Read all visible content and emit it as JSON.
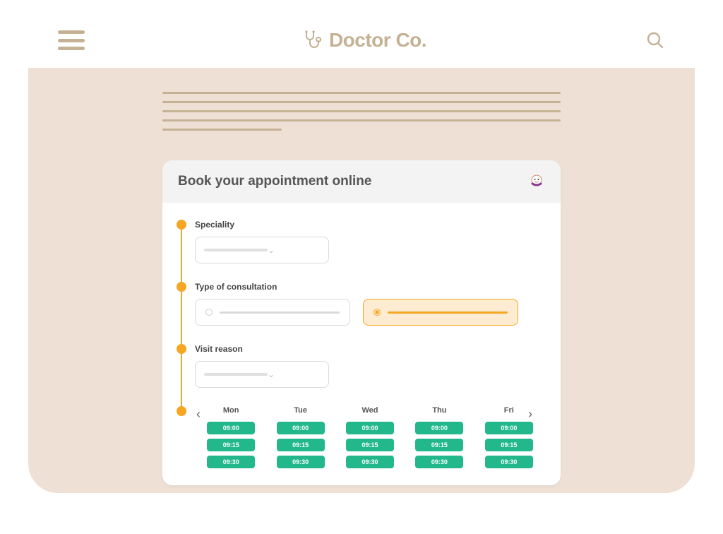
{
  "header": {
    "brand": "Doctor Co."
  },
  "booking": {
    "title": "Book your appointment online",
    "steps": {
      "speciality_label": "Speciality",
      "consultation_label": "Type of consultation",
      "visit_label": "Visit reason"
    },
    "calendar": {
      "days": [
        "Mon",
        "Tue",
        "Wed",
        "Thu",
        "Fri"
      ],
      "slots": [
        "09:00",
        "09:15",
        "09:30"
      ]
    }
  }
}
